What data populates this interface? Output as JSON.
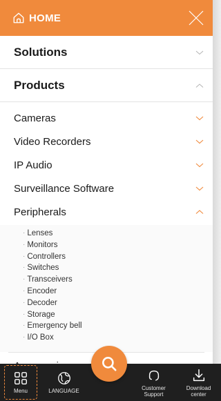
{
  "header": {
    "home_label": "HOME",
    "icons": {
      "home": "home-icon",
      "close": "close-icon"
    },
    "accent": "#f08a3c"
  },
  "menu": {
    "solutions": {
      "label": "Solutions",
      "state": "collapsed"
    },
    "products": {
      "label": "Products",
      "state": "expanded",
      "children": {
        "cameras": "Cameras",
        "video_recorders": "Video Recorders",
        "ip_audio": "IP Audio",
        "surveillance_software": "Surveillance Software",
        "peripherals": {
          "label": "Peripherals",
          "state": "expanded",
          "items": [
            "Lenses",
            "Monitors",
            "Controllers",
            "Switches",
            "Transceivers",
            "Encoder",
            "Decoder",
            "Storage",
            "Emergency bell",
            "I/O Box"
          ]
        },
        "accessories": "Accessories"
      }
    }
  },
  "bottom_nav": {
    "menu": "Menu",
    "language": "LANGUAGE",
    "search_icon": "search-icon",
    "customer_support": [
      "Customer",
      "Support"
    ],
    "download_center": [
      "Download",
      "center"
    ],
    "bar_color": "#1f1f1f"
  }
}
